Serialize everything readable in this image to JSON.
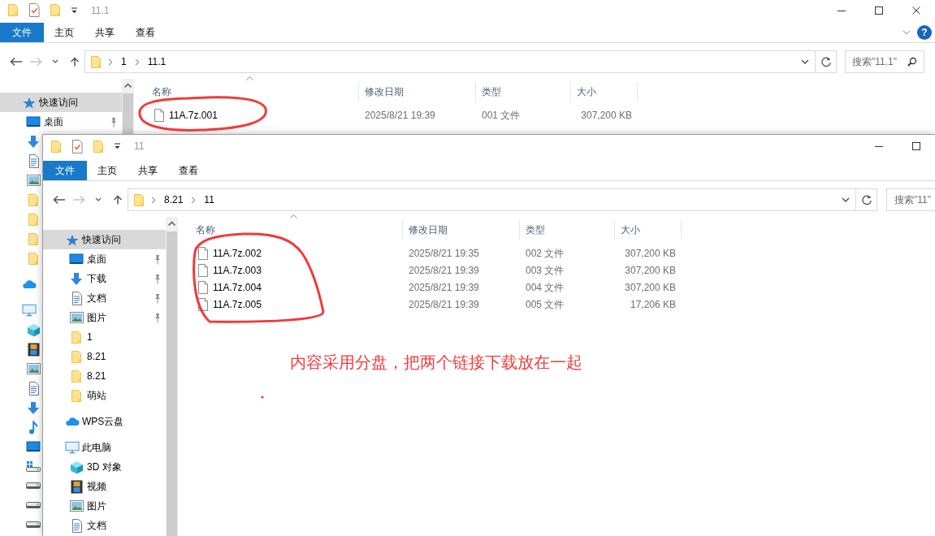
{
  "windows": [
    {
      "title": "11.1",
      "window_buttons": [
        {
          "kind": "minimize"
        },
        {
          "kind": "maximize"
        },
        {
          "kind": "close"
        }
      ],
      "ribbon_tabs": [
        {
          "label": "文件",
          "selected": true
        },
        {
          "label": "主页",
          "selected": false
        },
        {
          "label": "共享",
          "selected": false
        },
        {
          "label": "查看",
          "selected": false
        }
      ],
      "help": "?",
      "nav_buttons": [
        {
          "kind": "back",
          "disabled": false
        },
        {
          "kind": "forward",
          "disabled": true
        },
        {
          "kind": "recent",
          "disabled": false
        },
        {
          "kind": "up",
          "disabled": false
        }
      ],
      "address": [
        "1",
        "11.1"
      ],
      "search": {
        "placeholder": "搜索\"11.1\"",
        "icon": true
      },
      "nav": [
        {
          "label": "快速访问",
          "kind": "star",
          "selected": true,
          "pinned": false,
          "children": [
            {
              "label": "桌面",
              "kind": "desktop",
              "selected": false,
              "pinned": true
            },
            {
              "kind": "download",
              "selected": false,
              "pinned": false
            },
            {
              "kind": "doc",
              "selected": false,
              "pinned": false
            },
            {
              "kind": "picture",
              "selected": false,
              "pinned": false
            },
            {
              "kind": "folder",
              "selected": false,
              "pinned": false
            },
            {
              "kind": "folder",
              "selected": false,
              "pinned": false
            },
            {
              "kind": "folder",
              "selected": false,
              "pinned": false
            },
            {
              "kind": "folder",
              "selected": false,
              "pinned": false
            }
          ]
        },
        {
          "kind": "cloud",
          "selected": false,
          "pinned": false
        },
        {
          "kind": "pc",
          "selected": false,
          "pinned": false,
          "children": [
            {
              "kind": "cube",
              "selected": false,
              "pinned": false
            },
            {
              "kind": "video",
              "selected": false,
              "pinned": false
            },
            {
              "kind": "picture",
              "selected": false,
              "pinned": false
            },
            {
              "kind": "doc",
              "selected": false,
              "pinned": false
            },
            {
              "kind": "download",
              "selected": false,
              "pinned": false
            },
            {
              "kind": "music",
              "selected": false,
              "pinned": false
            },
            {
              "kind": "desktop",
              "selected": false,
              "pinned": false
            },
            {
              "kind": "windrive",
              "selected": false,
              "pinned": false
            },
            {
              "kind": "drive",
              "selected": false,
              "pinned": false
            },
            {
              "kind": "drive",
              "selected": false,
              "pinned": false
            },
            {
              "kind": "drive",
              "selected": false,
              "pinned": false
            }
          ]
        }
      ],
      "columns": [
        "名称",
        "修改日期",
        "类型",
        "大小"
      ],
      "rows": [
        {
          "name": "11A.7z.001",
          "date": "2025/8/21 19:39",
          "type": "001 文件",
          "size": "307,200 KB"
        }
      ]
    },
    {
      "title": "11",
      "window_buttons": [
        {
          "kind": "minimize"
        },
        {
          "kind": "maximize"
        }
      ],
      "ribbon_tabs": [
        {
          "label": "文件",
          "selected": true
        },
        {
          "label": "主页",
          "selected": false
        },
        {
          "label": "共享",
          "selected": false
        },
        {
          "label": "查看",
          "selected": false
        }
      ],
      "nav_buttons": [
        {
          "kind": "back",
          "disabled": false
        },
        {
          "kind": "forward",
          "disabled": true
        },
        {
          "kind": "recent",
          "disabled": false
        },
        {
          "kind": "up",
          "disabled": false
        }
      ],
      "address": [
        "8.21",
        "11"
      ],
      "search": {
        "placeholder": "搜索\"11\"",
        "icon": false
      },
      "nav": [
        {
          "label": "快速访问",
          "kind": "star",
          "selected": true,
          "pinned": false,
          "children": [
            {
              "label": "桌面",
              "kind": "desktop",
              "selected": false,
              "pinned": true
            },
            {
              "label": "下载",
              "kind": "download",
              "selected": false,
              "pinned": true
            },
            {
              "label": "文档",
              "kind": "doc",
              "selected": false,
              "pinned": true
            },
            {
              "label": "图片",
              "kind": "picture",
              "selected": false,
              "pinned": true
            },
            {
              "label": "1",
              "kind": "folder",
              "selected": false,
              "pinned": false
            },
            {
              "label": "8.21",
              "kind": "folder",
              "selected": false,
              "pinned": false
            },
            {
              "label": "8.21",
              "kind": "folder",
              "selected": false,
              "pinned": false
            },
            {
              "label": "萌站",
              "kind": "folder",
              "selected": false,
              "pinned": false
            }
          ]
        },
        {
          "label": "WPS云盘",
          "kind": "cloud",
          "selected": false,
          "pinned": false
        },
        {
          "label": "此电脑",
          "kind": "pc",
          "selected": false,
          "pinned": false,
          "children": [
            {
              "label": "3D 对象",
              "kind": "cube",
              "selected": false,
              "pinned": false
            },
            {
              "label": "视频",
              "kind": "video",
              "selected": false,
              "pinned": false
            },
            {
              "label": "图片",
              "kind": "picture",
              "selected": false,
              "pinned": false
            },
            {
              "label": "文档",
              "kind": "doc",
              "selected": false,
              "pinned": false
            }
          ]
        }
      ],
      "columns": [
        "名称",
        "修改日期",
        "类型",
        "大小"
      ],
      "rows": [
        {
          "name": "11A.7z.002",
          "date": "2025/8/21 19:35",
          "type": "002 文件",
          "size": "307,200 KB"
        },
        {
          "name": "11A.7z.003",
          "date": "2025/8/21 19:39",
          "type": "003 文件",
          "size": "307,200 KB"
        },
        {
          "name": "11A.7z.004",
          "date": "2025/8/21 19:39",
          "type": "004 文件",
          "size": "307,200 KB"
        },
        {
          "name": "11A.7z.005",
          "date": "2025/8/21 19:39",
          "type": "005 文件",
          "size": "17,206 KB"
        }
      ]
    }
  ],
  "annotation": "内容采用分盘，把两个链接下载放在一起"
}
